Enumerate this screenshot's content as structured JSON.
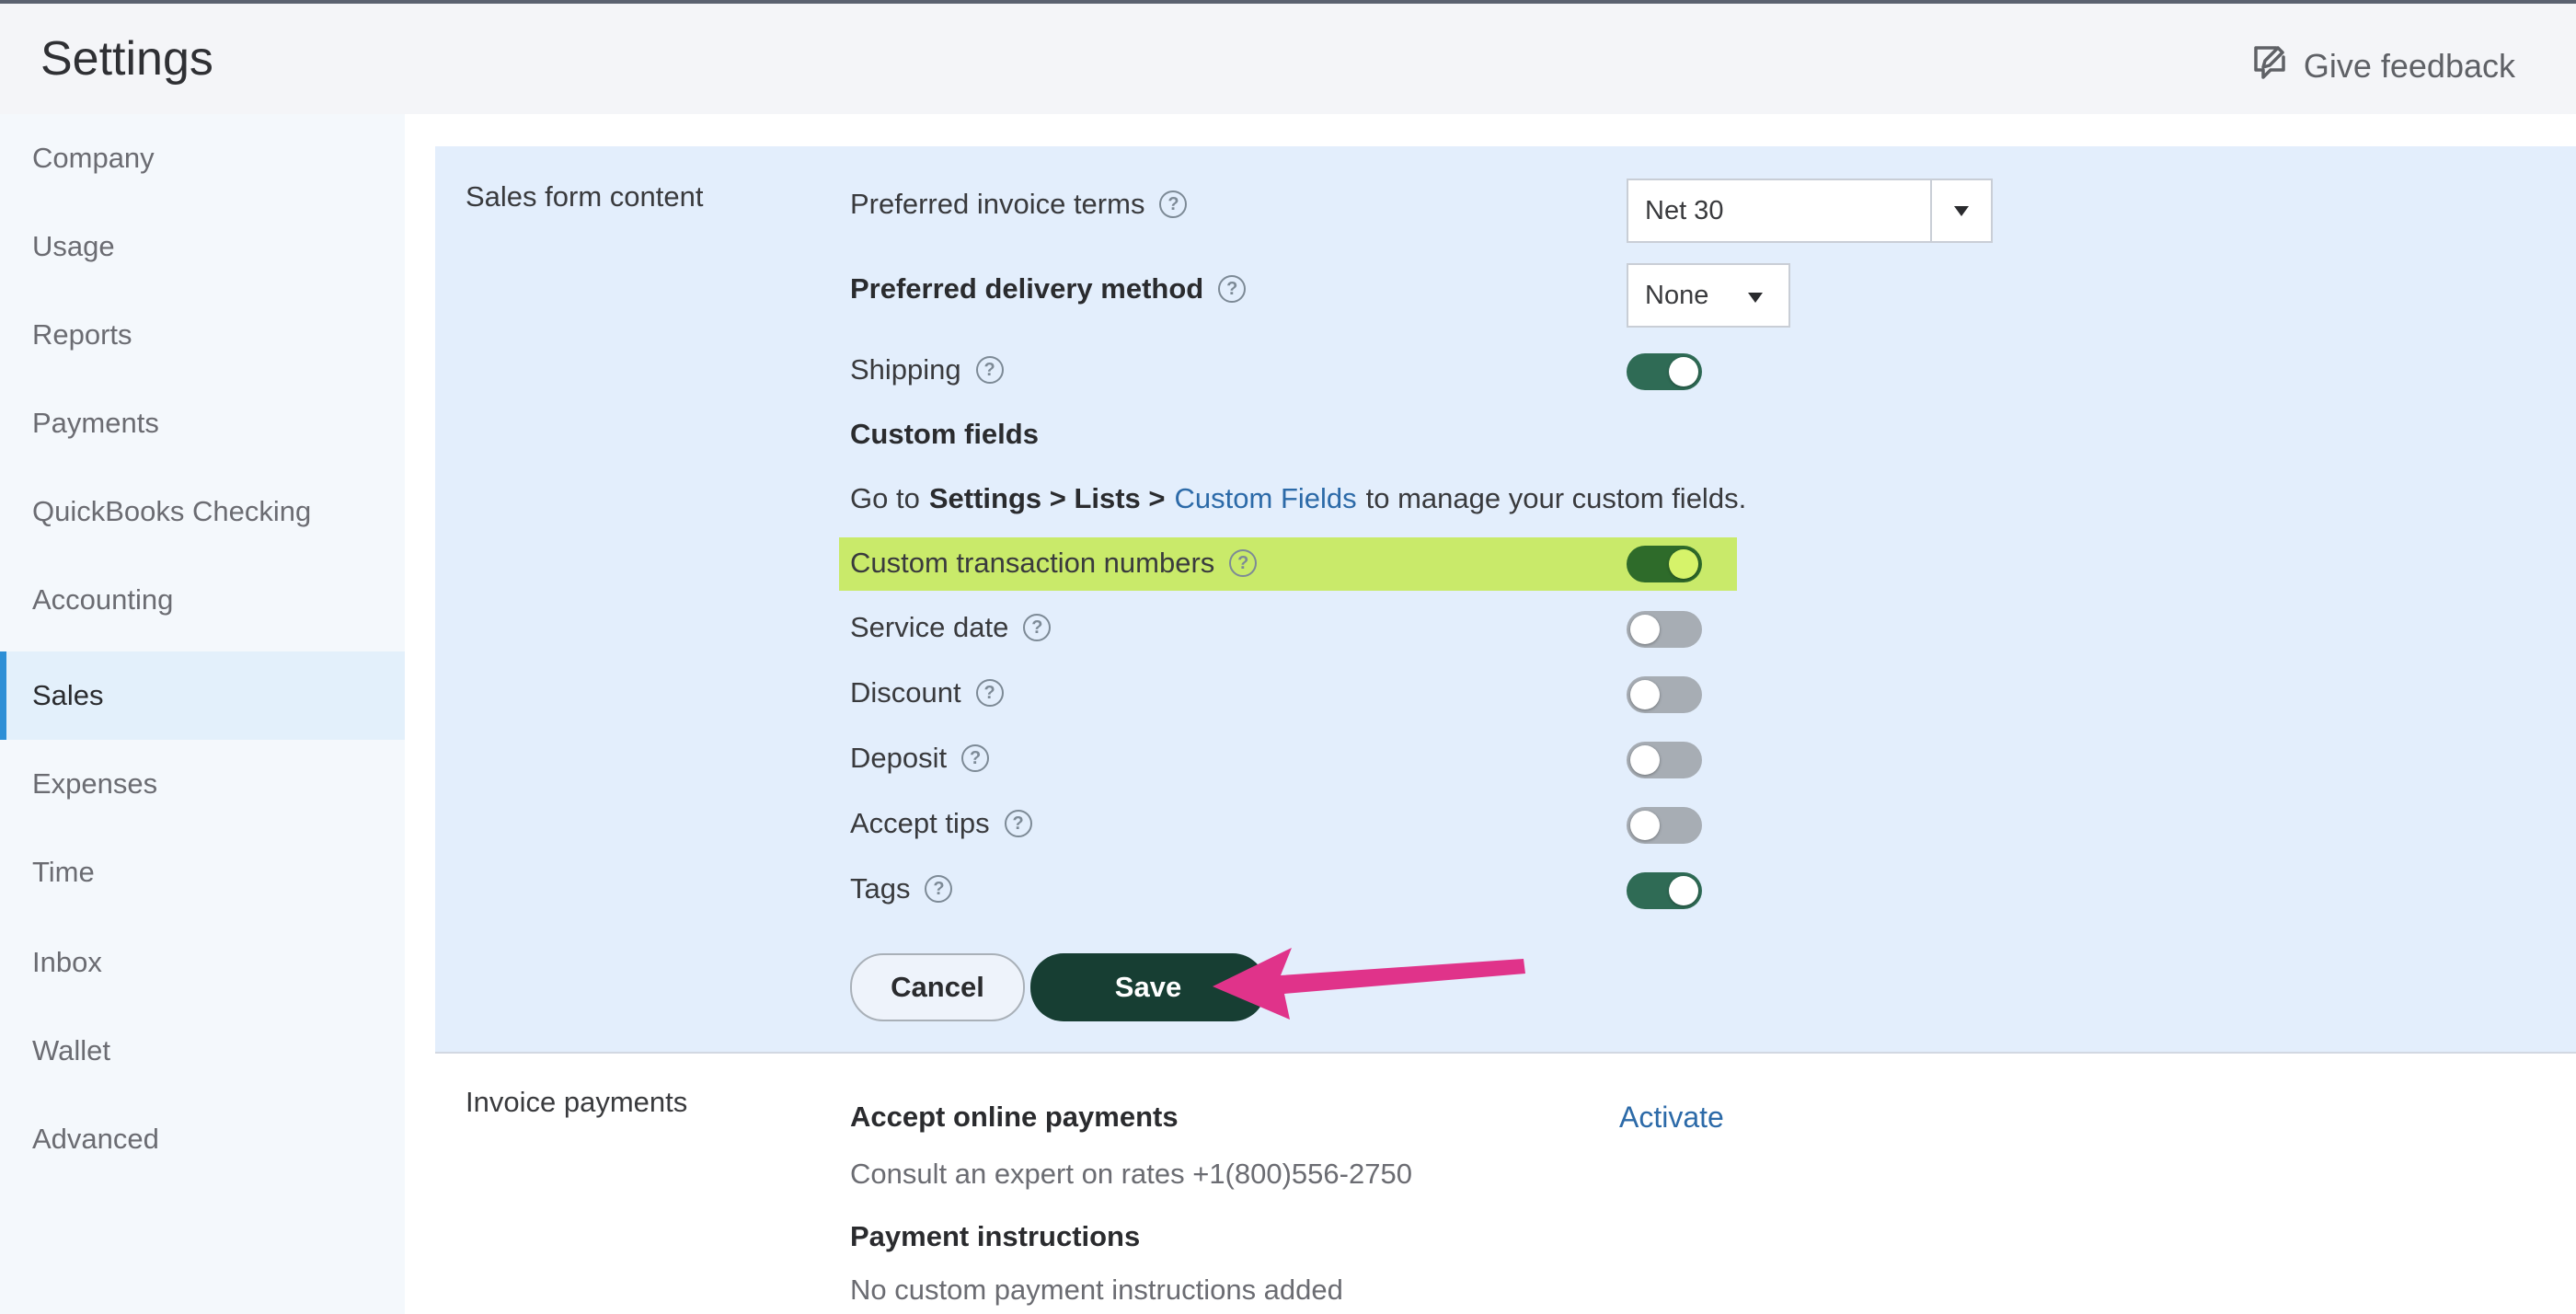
{
  "header": {
    "title": "Settings",
    "feedback_label": "Give feedback",
    "feedback_icon": "feedback-icon"
  },
  "sidebar": {
    "items": [
      {
        "label": "Company"
      },
      {
        "label": "Usage"
      },
      {
        "label": "Reports"
      },
      {
        "label": "Payments"
      },
      {
        "label": "QuickBooks Checking"
      },
      {
        "label": "Accounting"
      },
      {
        "label": "Sales",
        "active": true
      },
      {
        "label": "Expenses"
      },
      {
        "label": "Time"
      },
      {
        "label": "Inbox"
      },
      {
        "label": "Wallet"
      },
      {
        "label": "Advanced"
      }
    ]
  },
  "sales_form": {
    "title": "Sales form content",
    "invoice_terms": {
      "label": "Preferred invoice terms",
      "value": "Net 30"
    },
    "delivery_method": {
      "label": "Preferred delivery method",
      "value": "None"
    },
    "shipping": {
      "label": "Shipping",
      "on": true
    },
    "custom_fields": {
      "heading": "Custom fields",
      "goto_prefix": "Go to",
      "goto_bold": "Settings > Lists >",
      "goto_link": "Custom Fields",
      "goto_suffix": "to manage your custom fields."
    },
    "custom_numbers": {
      "label": "Custom transaction numbers",
      "on": true
    },
    "service_date": {
      "label": "Service date",
      "on": false
    },
    "discount": {
      "label": "Discount",
      "on": false
    },
    "deposit": {
      "label": "Deposit",
      "on": false
    },
    "accept_tips": {
      "label": "Accept tips",
      "on": false
    },
    "tags": {
      "label": "Tags",
      "on": true
    },
    "cancel_label": "Cancel",
    "save_label": "Save"
  },
  "invoice_payments": {
    "title": "Invoice payments",
    "accept_online": "Accept online payments",
    "activate_label": "Activate",
    "consult": "Consult an expert on rates +1(800)556-2750",
    "instructions_heading": "Payment instructions",
    "instructions_text": "No custom payment instructions added"
  },
  "colors": {
    "accent_green": "#2f6b55",
    "save_dark": "#173e33",
    "highlight": "#c9ea6a",
    "annotation_arrow": "#e0338a",
    "link": "#2c6aa8"
  }
}
